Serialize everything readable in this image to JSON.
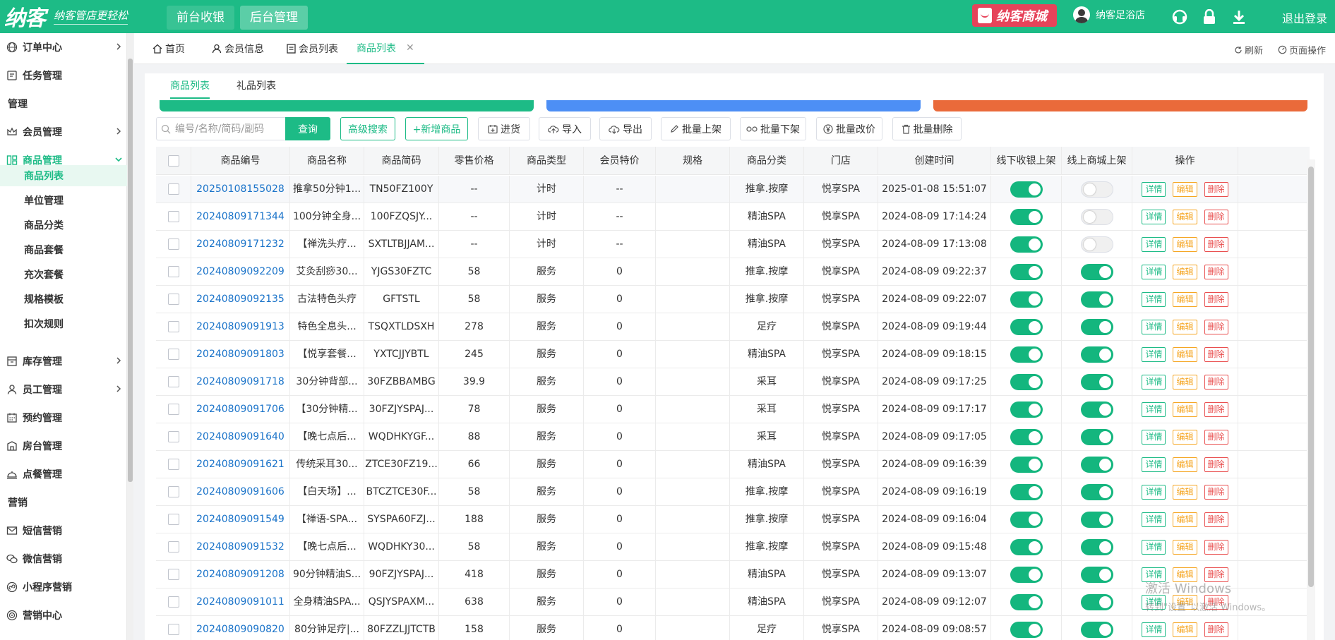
{
  "app": {
    "logo_main": "纳客",
    "logo_slogan": "纳客管店更轻松",
    "nav": [
      "前台收银",
      "后台管理"
    ],
    "mall": "纳客商城",
    "user": "纳客足浴店",
    "logout": "退出登录"
  },
  "sidebar": {
    "items": [
      {
        "label": "订单中心",
        "icon": "globe-icon",
        "chevron": true
      },
      {
        "label": "任务管理",
        "icon": "task-icon",
        "chevron": false
      },
      {
        "label": "管理",
        "icon": "",
        "chevron": false,
        "group": true
      },
      {
        "label": "会员管理",
        "icon": "crown-icon",
        "chevron": true
      },
      {
        "label": "商品管理",
        "icon": "product-icon",
        "chevron": true,
        "open": true
      },
      {
        "label": "库存管理",
        "icon": "inventory-icon",
        "chevron": true
      },
      {
        "label": "员工管理",
        "icon": "user-icon",
        "chevron": true
      },
      {
        "label": "预约管理",
        "icon": "calendar-icon",
        "chevron": false
      },
      {
        "label": "房台管理",
        "icon": "room-icon",
        "chevron": false
      },
      {
        "label": "点餐管理",
        "icon": "dining-icon",
        "chevron": false
      },
      {
        "label": "营销",
        "icon": "",
        "chevron": false,
        "group": true
      },
      {
        "label": "短信营销",
        "icon": "mail-icon",
        "chevron": false
      },
      {
        "label": "微信营销",
        "icon": "wechat-icon",
        "chevron": false
      },
      {
        "label": "小程序营销",
        "icon": "miniprogram-icon",
        "chevron": false
      },
      {
        "label": "营销中心",
        "icon": "target-icon",
        "chevron": false
      }
    ],
    "sub_items": [
      "商品列表",
      "单位管理",
      "商品分类",
      "商品套餐",
      "充次套餐",
      "规格模板",
      "扣次规则"
    ],
    "active_sub": "商品列表"
  },
  "tabs": {
    "items": [
      "首页",
      "会员信息",
      "会员列表",
      "商品列表"
    ],
    "active": "商品列表",
    "refresh": "刷新",
    "page_ops": "页面操作"
  },
  "subtabs": [
    "商品列表",
    "礼品列表"
  ],
  "colors": {
    "brand": "#1dbb86",
    "bar_green": "#1dbb86",
    "bar_blue": "#4d8ff5",
    "bar_orange": "#ea6a3a",
    "link": "#1a73c9",
    "edit": "#f5a623",
    "delete": "#e94e4e"
  },
  "toolbar": {
    "search_placeholder": "编号/名称/简码/副码",
    "query": "查询",
    "advanced": "高级搜索",
    "add": "+新增商品",
    "stock_in": "进货",
    "import": "导入",
    "export": "导出",
    "batch_on": "批量上架",
    "batch_off": "批量下架",
    "batch_price": "批量改价",
    "batch_delete": "批量删除"
  },
  "table": {
    "headers": [
      "",
      "商品编号",
      "商品名称",
      "商品简码",
      "零售价格",
      "商品类型",
      "会员特价",
      "规格",
      "商品分类",
      "门店",
      "创建时间",
      "线下收银上架",
      "线上商城上架",
      "操作"
    ],
    "actions": {
      "detail": "详情",
      "edit": "编辑",
      "delete": "删除"
    },
    "rows": [
      {
        "code": "20250108155028",
        "name": "推拿50分钟1...",
        "short": "TN50FZ100Y",
        "price": "--",
        "type": "计时",
        "member": "--",
        "spec": "",
        "category": "推拿.按摩",
        "store": "悦享SPA",
        "created": "2025-01-08 15:51:07",
        "offline": true,
        "online": false
      },
      {
        "code": "20240809171344",
        "name": "100分钟全身...",
        "short": "100FZQSJY...",
        "price": "--",
        "type": "计时",
        "member": "--",
        "spec": "",
        "category": "精油SPA",
        "store": "悦享SPA",
        "created": "2024-08-09 17:14:24",
        "offline": true,
        "online": false
      },
      {
        "code": "20240809171232",
        "name": "【禅洗头疗...",
        "short": "SXTLTBJJAM...",
        "price": "--",
        "type": "计时",
        "member": "--",
        "spec": "",
        "category": "精油SPA",
        "store": "悦享SPA",
        "created": "2024-08-09 17:13:08",
        "offline": true,
        "online": false
      },
      {
        "code": "20240809092209",
        "name": "艾灸刮痧30...",
        "short": "YJGS30FZTC",
        "price": "58",
        "type": "服务",
        "member": "0",
        "spec": "",
        "category": "推拿.按摩",
        "store": "悦享SPA",
        "created": "2024-08-09 09:22:37",
        "offline": true,
        "online": true
      },
      {
        "code": "20240809092135",
        "name": "古法特色头疗",
        "short": "GFTSTL",
        "price": "58",
        "type": "服务",
        "member": "0",
        "spec": "",
        "category": "推拿.按摩",
        "store": "悦享SPA",
        "created": "2024-08-09 09:22:07",
        "offline": true,
        "online": true
      },
      {
        "code": "20240809091913",
        "name": "特色全息头...",
        "short": "TSQXTLDSXH",
        "price": "278",
        "type": "服务",
        "member": "0",
        "spec": "",
        "category": "足疗",
        "store": "悦享SPA",
        "created": "2024-08-09 09:19:44",
        "offline": true,
        "online": true
      },
      {
        "code": "20240809091803",
        "name": "【悦享套餐...",
        "short": "YXTCJJYBTL",
        "price": "245",
        "type": "服务",
        "member": "0",
        "spec": "",
        "category": "精油SPA",
        "store": "悦享SPA",
        "created": "2024-08-09 09:18:15",
        "offline": true,
        "online": true
      },
      {
        "code": "20240809091718",
        "name": "30分钟背部...",
        "short": "30FZBBAMBG",
        "price": "39.9",
        "type": "服务",
        "member": "0",
        "spec": "",
        "category": "采耳",
        "store": "悦享SPA",
        "created": "2024-08-09 09:17:25",
        "offline": true,
        "online": true
      },
      {
        "code": "20240809091706",
        "name": "【30分钟精...",
        "short": "30FZJYSPAJ...",
        "price": "78",
        "type": "服务",
        "member": "0",
        "spec": "",
        "category": "采耳",
        "store": "悦享SPA",
        "created": "2024-08-09 09:17:17",
        "offline": true,
        "online": true
      },
      {
        "code": "20240809091640",
        "name": "【晚七点后...",
        "short": "WQDHKYGF...",
        "price": "88",
        "type": "服务",
        "member": "0",
        "spec": "",
        "category": "采耳",
        "store": "悦享SPA",
        "created": "2024-08-09 09:17:05",
        "offline": true,
        "online": true
      },
      {
        "code": "20240809091621",
        "name": "传统采耳30...",
        "short": "ZTCE30FZ19...",
        "price": "66",
        "type": "服务",
        "member": "0",
        "spec": "",
        "category": "精油SPA",
        "store": "悦享SPA",
        "created": "2024-08-09 09:16:39",
        "offline": true,
        "online": true
      },
      {
        "code": "20240809091606",
        "name": "【白天场】...",
        "short": "BTCZTCE30F...",
        "price": "58",
        "type": "服务",
        "member": "0",
        "spec": "",
        "category": "推拿.按摩",
        "store": "悦享SPA",
        "created": "2024-08-09 09:16:19",
        "offline": true,
        "online": true
      },
      {
        "code": "20240809091549",
        "name": "【禅语-SPA...",
        "short": "SYSPA60FZJ...",
        "price": "188",
        "type": "服务",
        "member": "0",
        "spec": "",
        "category": "推拿.按摩",
        "store": "悦享SPA",
        "created": "2024-08-09 09:16:04",
        "offline": true,
        "online": true
      },
      {
        "code": "20240809091532",
        "name": "【晚七点后...",
        "short": "WQDHKY30...",
        "price": "58",
        "type": "服务",
        "member": "0",
        "spec": "",
        "category": "推拿.按摩",
        "store": "悦享SPA",
        "created": "2024-08-09 09:15:48",
        "offline": true,
        "online": true
      },
      {
        "code": "20240809091208",
        "name": "90分钟精油S...",
        "short": "90FZJYSPAJ...",
        "price": "418",
        "type": "服务",
        "member": "0",
        "spec": "",
        "category": "精油SPA",
        "store": "悦享SPA",
        "created": "2024-08-09 09:13:07",
        "offline": true,
        "online": true
      },
      {
        "code": "20240809091011",
        "name": "全身精油SPA...",
        "short": "QSJYSPAXM...",
        "price": "638",
        "type": "服务",
        "member": "0",
        "spec": "",
        "category": "精油SPA",
        "store": "悦享SPA",
        "created": "2024-08-09 09:12:07",
        "offline": true,
        "online": true
      },
      {
        "code": "20240809090820",
        "name": "80分钟足疗|...",
        "short": "80FZZLJJTCTB",
        "price": "158",
        "type": "服务",
        "member": "0",
        "spec": "",
        "category": "足疗",
        "store": "悦享SPA",
        "created": "2024-08-09 09:08:57",
        "offline": true,
        "online": true
      }
    ]
  },
  "watermark": {
    "line1": "激活 Windows",
    "line2": "转到\"设置\"以激活 Windows。"
  }
}
